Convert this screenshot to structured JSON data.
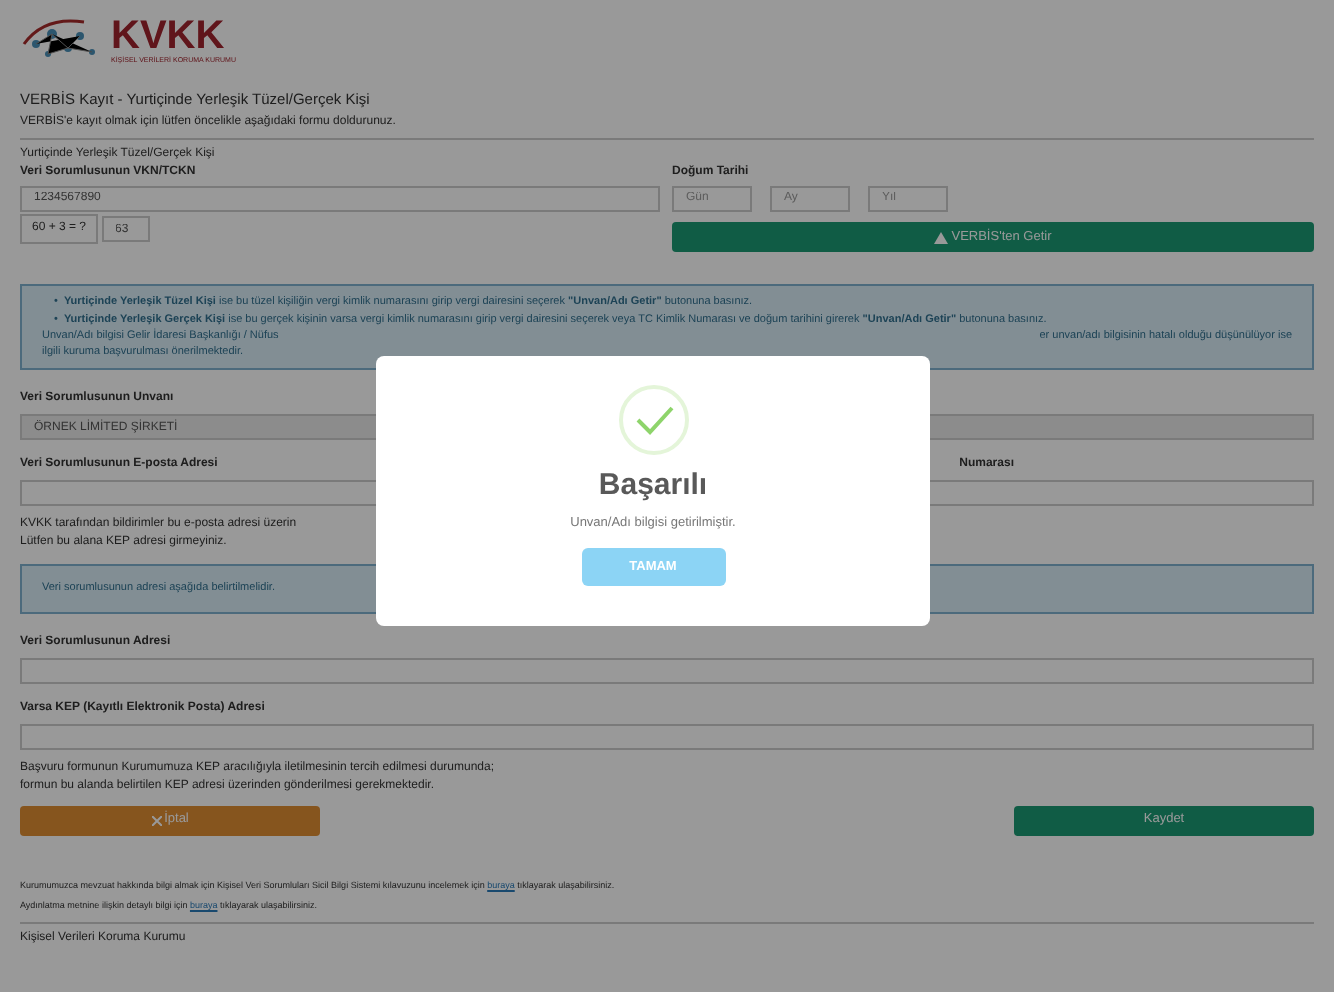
{
  "logo": {
    "text": "KVKK",
    "subtitle": "KİŞİSEL VERİLERİ KORUMA KURUMU"
  },
  "page": {
    "title": "VERBİS Kayıt - Yurtiçinde Yerleşik Tüzel/Gerçek Kişi",
    "subtitle": "VERBİS'e kayıt olmak için lütfen öncelikle aşağıdaki formu doldurunuz."
  },
  "section": "Yurtiçinde Yerleşik Tüzel/Gerçek Kişi",
  "vkn": {
    "label": "Veri Sorumlusunun VKN/TCKN",
    "value": "1234567890"
  },
  "captcha": {
    "question": "60 + 3 = ?",
    "value": "63"
  },
  "birth": {
    "label": "Doğum Tarihi",
    "fields": [
      {
        "placeholder": "Gün"
      },
      {
        "placeholder": "Ay"
      },
      {
        "placeholder": "Yıl"
      }
    ]
  },
  "fetch_button": "VERBİS'ten Getir",
  "info": {
    "marker": "•",
    "bullets": [
      "**Yurtiçinde Yerleşik Tüzel Kişi** ise bu tüzel kişiliğin vergi kimlik numarasını girip vergi dairesini seçerek **\"Unvan/Adı Getir\"** butonuna basınız.",
      "**Yurtiçinde Yerleşik Gerçek Kişi** ise bu gerçek kişinin varsa vergi kimlik numarasını girip vergi dairesini seçerek veya TC Kimlik Numarası ve doğum tarihini girerek **\"Unvan/Adı Getir\"** butonuna basınız."
    ],
    "note_left": "Unvan/Adı bilgisi Gelir İdaresi Başkanlığı / Nüfus",
    "note_right": "er unvan/adı bilgisinin hatalı olduğu düşünülüyor ise",
    "note_line2": "ilgili kuruma başvurulması önerilmektedir."
  },
  "title_field": {
    "label": "Veri Sorumlusunun Unvanı",
    "value": "ÖRNEK LİMİTED ŞİRKETİ"
  },
  "email": {
    "label": "Veri Sorumlusunun E-posta Adresi",
    "right_label": "Numarası",
    "note1": "KVKK tarafından bildirimler bu e-posta adresi üzerin",
    "note2": "Lütfen bu alana KEP adresi girmeyiniz."
  },
  "address_info": "Veri sorumlusunun adresi aşağıda belirtilmelidir.",
  "address": {
    "label": "Veri Sorumlusunun Adresi"
  },
  "kep": {
    "label": "Varsa KEP (Kayıtlı Elektronik Posta) Adresi",
    "note1": "Başvuru formunun Kurumumuza KEP aracılığıyla iletilmesinin tercih edilmesi durumunda;",
    "note2": "formun bu alanda belirtilen KEP adresi üzerinden gönderilmesi gerekmektedir."
  },
  "buttons": [
    {
      "kind": "cancel",
      "label": "İptal"
    },
    {
      "kind": "save",
      "label": "Kaydet"
    }
  ],
  "footer": [
    {
      "text": "Kurumumuzca mevzuat hakkında bilgi almak için Kişisel Veri Sorumluları Sicil Bilgi Sistemi kılavuzunu incelemek için",
      "link": "buraya",
      "after": "tıklayarak ulaşabilirsiniz."
    },
    {
      "text": "Aydınlatma metnine ilişkin detaylı bilgi için",
      "link": "buraya",
      "after": "tıklayarak ulaşabilirsiniz."
    }
  ],
  "org": "Kişisel Verileri Koruma Kurumu",
  "modal": {
    "title": "Başarılı",
    "message": "Unvan/Adı bilgisi getirilmiştir.",
    "button": "TAMAM"
  }
}
